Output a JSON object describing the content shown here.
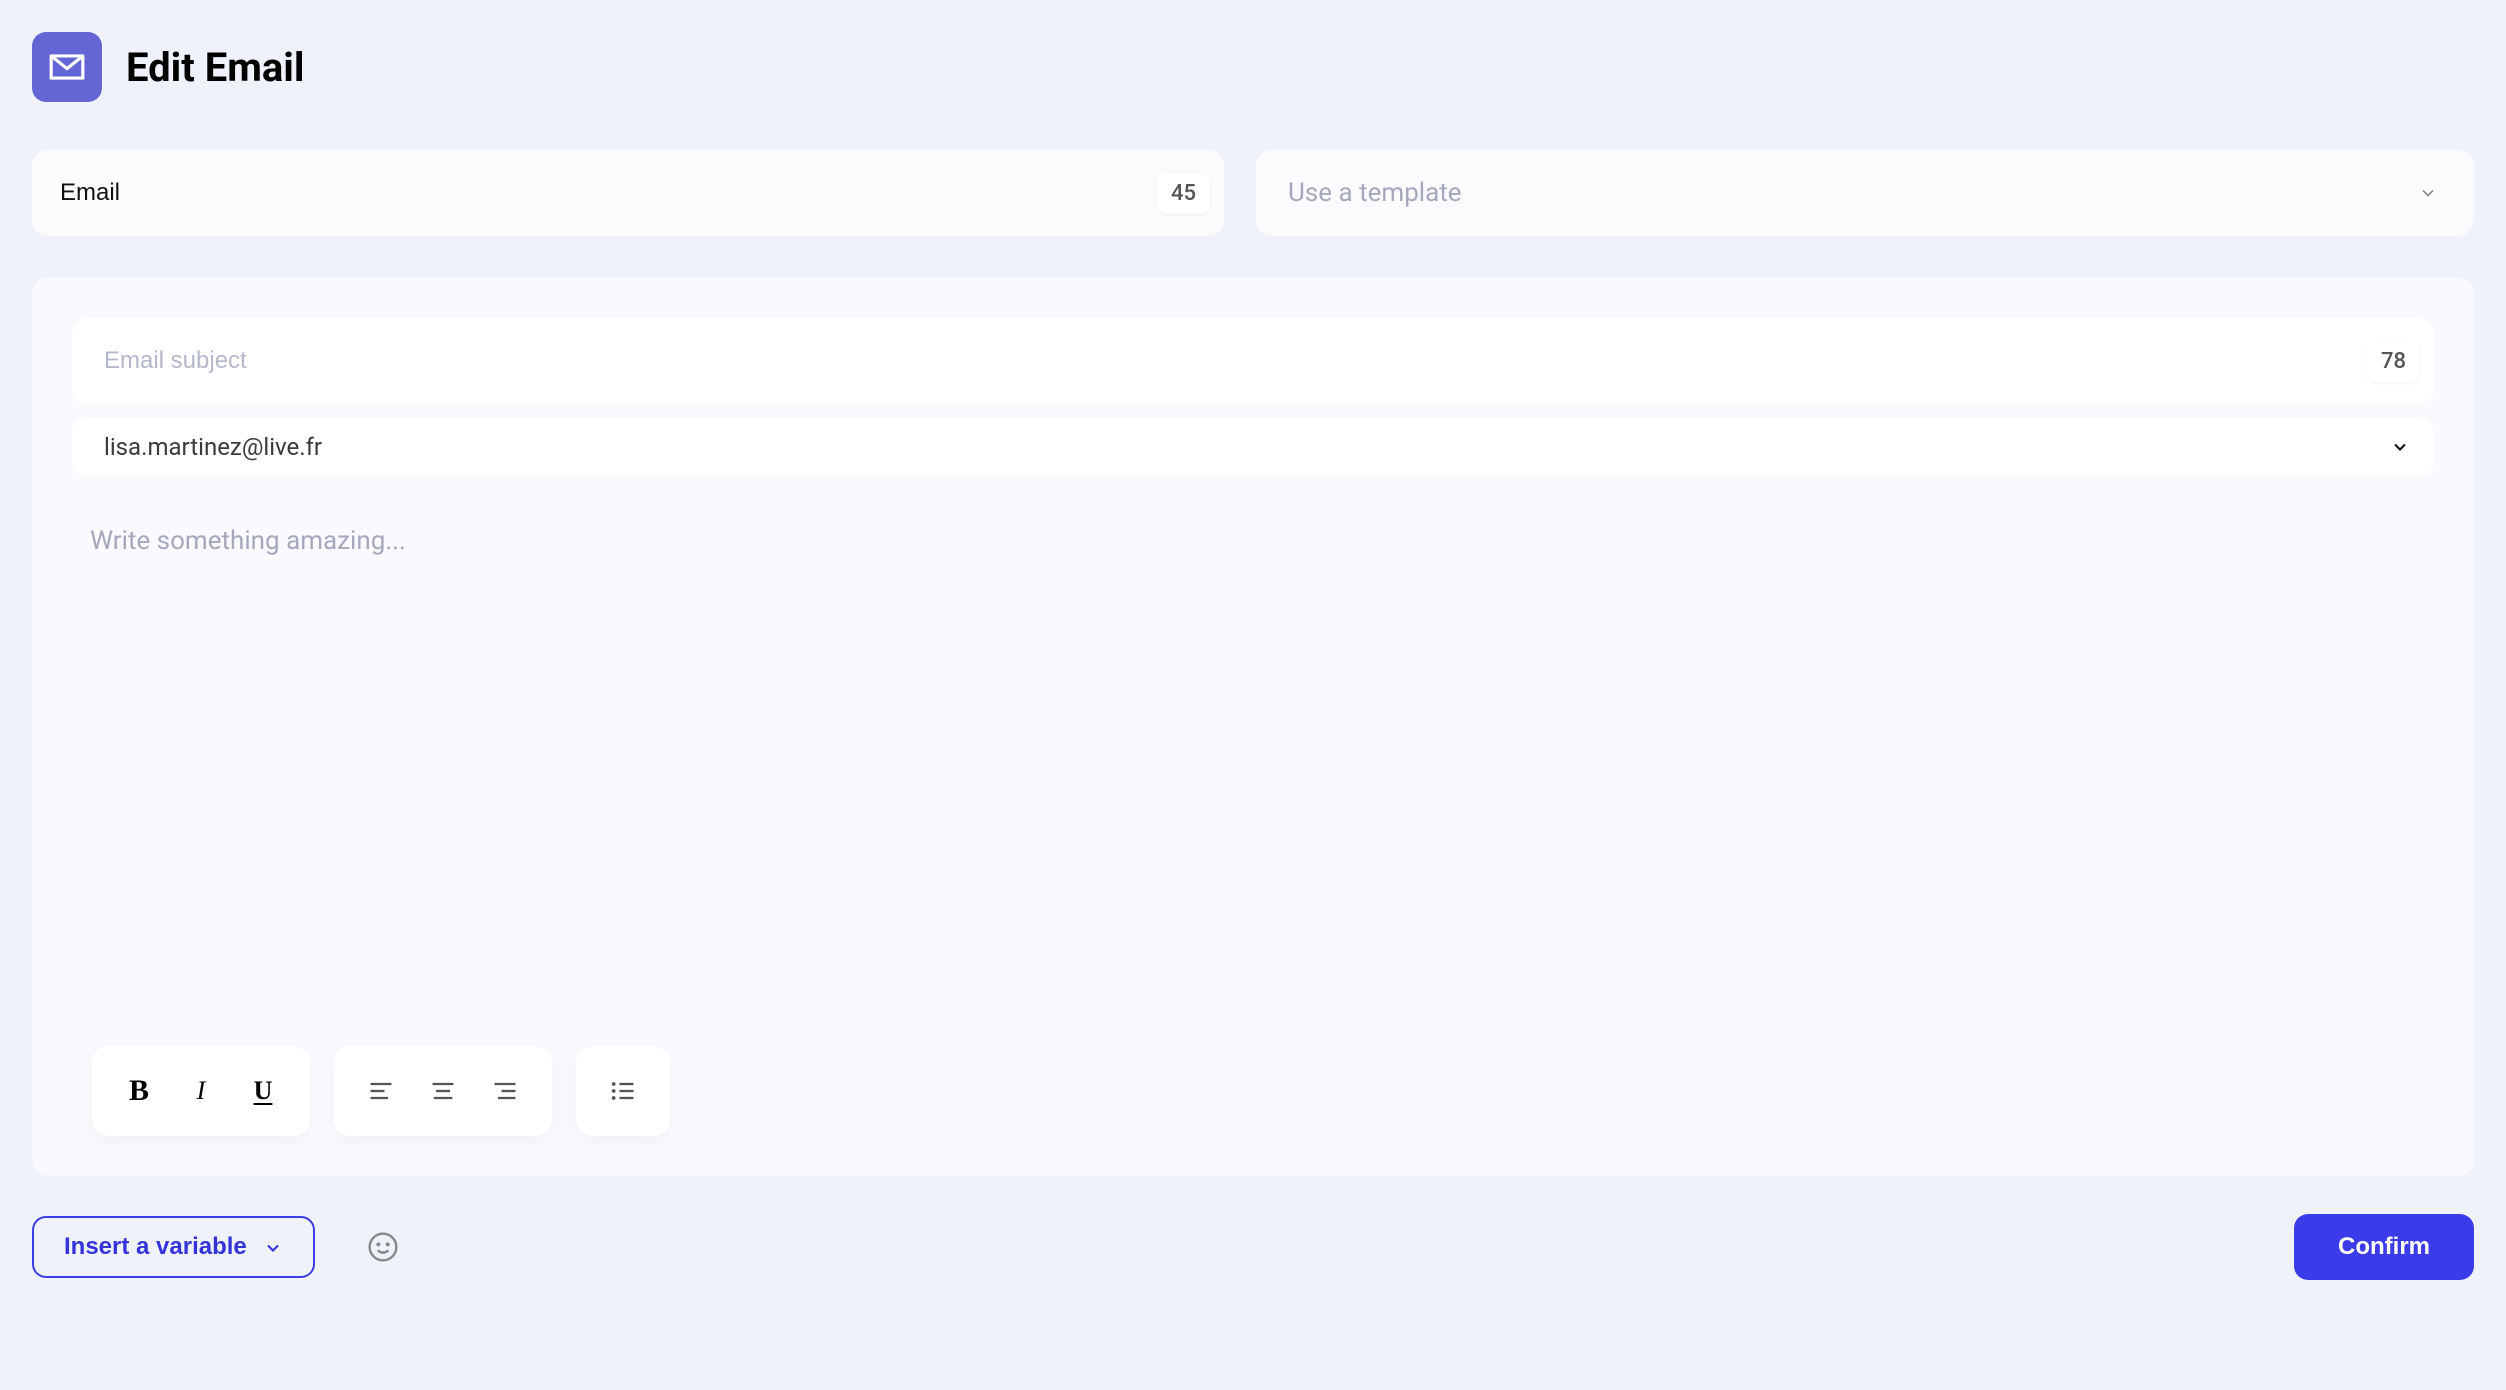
{
  "header": {
    "title": "Edit Email"
  },
  "emailField": {
    "value": "Email",
    "count": "45"
  },
  "templateSelect": {
    "placeholder": "Use a template"
  },
  "subjectField": {
    "placeholder": "Email subject",
    "count": "78"
  },
  "senderSelect": {
    "value": "lisa.martinez@live.fr"
  },
  "bodyEditor": {
    "placeholder": "Write something amazing..."
  },
  "footer": {
    "insertVariable": "Insert a variable",
    "confirm": "Confirm"
  }
}
